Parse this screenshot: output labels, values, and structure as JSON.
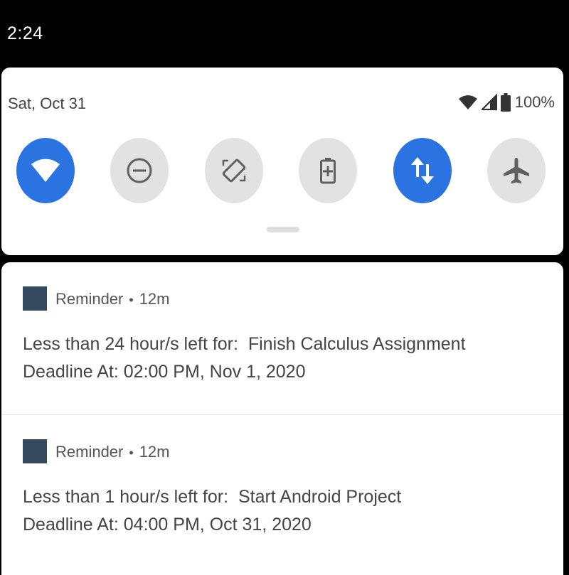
{
  "status_bar": {
    "time": "2:24"
  },
  "quick_settings": {
    "date": "Sat, Oct 31",
    "battery_level": "100%",
    "status_icons": [
      "wifi-icon",
      "cellular-signal-icon",
      "battery-icon"
    ],
    "tiles": [
      {
        "name": "wifi",
        "icon": "wifi-icon",
        "state": "on"
      },
      {
        "name": "do-not-disturb",
        "icon": "do-not-disturb-icon",
        "state": "off"
      },
      {
        "name": "auto-rotate",
        "icon": "auto-rotate-icon",
        "state": "off"
      },
      {
        "name": "battery-saver",
        "icon": "battery-saver-icon",
        "state": "off"
      },
      {
        "name": "mobile-data",
        "icon": "data-transfer-icon",
        "state": "on"
      },
      {
        "name": "airplane-mode",
        "icon": "airplane-icon",
        "state": "off"
      }
    ],
    "colors": {
      "tile_on": "#2b73e0",
      "tile_off": "#e2e2e2",
      "icon_off": "#5f5f5f"
    }
  },
  "notifications": [
    {
      "app_name": "Reminder",
      "separator": "•",
      "time_ago": "12m",
      "line1": "Less than 24 hour/s left for:  Finish Calculus Assignment",
      "line2": "Deadline At: 02:00 PM, Nov 1, 2020",
      "icon_color": "#34495e"
    },
    {
      "app_name": "Reminder",
      "separator": "•",
      "time_ago": "12m",
      "line1": "Less than 1 hour/s left for:  Start Android Project",
      "line2": "Deadline At: 04:00 PM, Oct 31, 2020",
      "icon_color": "#34495e"
    }
  ]
}
